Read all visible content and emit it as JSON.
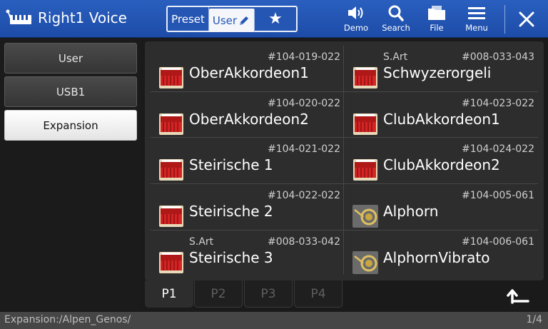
{
  "header": {
    "title": "Right1 Voice",
    "modes": {
      "preset": "Preset",
      "user": "User",
      "favorite_icon": "star-icon"
    },
    "tools": {
      "demo": "Demo",
      "search": "Search",
      "file": "File",
      "menu": "Menu"
    },
    "accent_color": "#2a5fbf"
  },
  "sidebar": {
    "items": [
      {
        "label": "User",
        "active": false
      },
      {
        "label": "USB1",
        "active": false
      },
      {
        "label": "Expansion",
        "active": true
      }
    ]
  },
  "voices": [
    {
      "number": "#104-019-022",
      "tag": "",
      "name": "OberAkkordeon1",
      "icon": "accordion-icon"
    },
    {
      "number": "#008-033-043",
      "tag": "S.Art",
      "name": "Schwyzerorgeli",
      "icon": "accordion-icon"
    },
    {
      "number": "#104-020-022",
      "tag": "",
      "name": "OberAkkordeon2",
      "icon": "accordion-icon"
    },
    {
      "number": "#104-023-022",
      "tag": "",
      "name": "ClubAkkordeon1",
      "icon": "accordion-icon"
    },
    {
      "number": "#104-021-022",
      "tag": "",
      "name": "Steirische 1",
      "icon": "accordion-icon"
    },
    {
      "number": "#104-024-022",
      "tag": "",
      "name": "ClubAkkordeon2",
      "icon": "accordion-icon"
    },
    {
      "number": "#104-022-022",
      "tag": "",
      "name": "Steirische 2",
      "icon": "accordion-icon"
    },
    {
      "number": "#104-005-061",
      "tag": "",
      "name": "Alphorn",
      "icon": "horn-icon"
    },
    {
      "number": "#008-033-042",
      "tag": "S.Art",
      "name": "Steirische 3",
      "icon": "accordion-icon"
    },
    {
      "number": "#104-006-061",
      "tag": "",
      "name": "AlphornVibrato",
      "icon": "horn-icon"
    }
  ],
  "tabs": [
    {
      "label": "P1",
      "active": true
    },
    {
      "label": "P2",
      "active": false
    },
    {
      "label": "P3",
      "active": false
    },
    {
      "label": "P4",
      "active": false
    }
  ],
  "status": {
    "path": "Expansion:/Alpen_Genos/",
    "page": "1/4"
  }
}
